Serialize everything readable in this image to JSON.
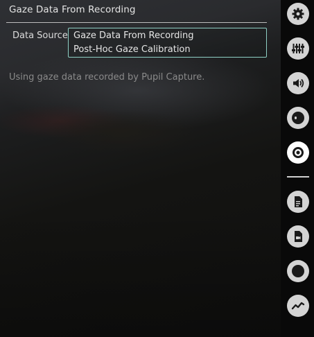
{
  "menu": {
    "title": "Gaze Data From Recording",
    "field_label": "Data Source",
    "options": [
      "Gaze Data From Recording",
      "Post-Hoc Gaze Calibration"
    ],
    "info": "Using gaze data recorded by Pupil Capture."
  },
  "iconbar": {
    "buttons": [
      {
        "name": "settings-gear-icon",
        "active": false
      },
      {
        "name": "plugin-manager-sliders-icon",
        "active": false
      },
      {
        "name": "audio-speaker-icon",
        "active": false
      },
      {
        "name": "video-overlay-icon",
        "active": false
      },
      {
        "name": "gaze-data-eye-icon",
        "active": true
      },
      {
        "name": "export-document-icon",
        "active": false
      },
      {
        "name": "video-export-icon",
        "active": false
      },
      {
        "name": "recording-circle-icon",
        "active": false
      },
      {
        "name": "timeline-chart-icon",
        "active": false
      }
    ],
    "colors": {
      "inactive": "#d4d4d4",
      "active": "#ffffff",
      "glyph": "#1a1a1a",
      "accent": "#8fd1c6"
    }
  }
}
